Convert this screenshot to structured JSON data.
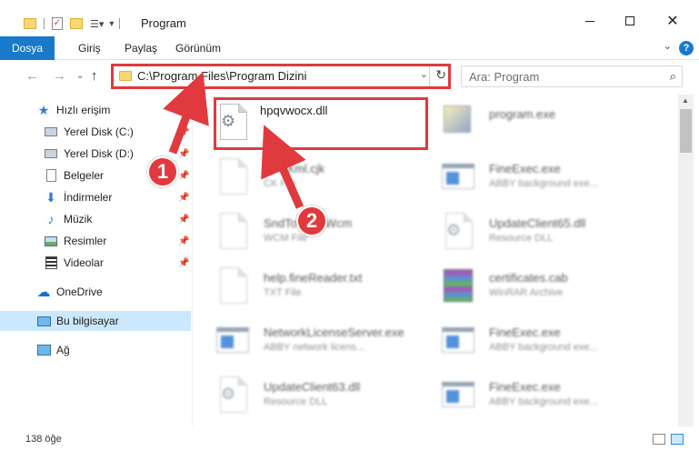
{
  "window": {
    "title": "Program",
    "min_icon": "minimize-icon",
    "max_icon": "maximize-icon",
    "close_icon": "close-icon"
  },
  "ribbon": {
    "tabs": [
      "Dosya",
      "Giriş",
      "Paylaş",
      "Görünüm"
    ],
    "accent": "#1979ca"
  },
  "nav": {
    "address": "C:\\Program Files\\Program Dizini",
    "search_placeholder": "Ara: Program"
  },
  "sidebar": {
    "items": [
      {
        "label": "Hızlı erişim",
        "icon": "star-icon"
      },
      {
        "label": "Yerel Disk (C:)",
        "icon": "drive-icon",
        "pinned": true
      },
      {
        "label": "Yerel Disk (D:)",
        "icon": "drive-icon",
        "pinned": true
      },
      {
        "label": "Belgeler",
        "icon": "document-icon",
        "pinned": true
      },
      {
        "label": "İndirmeler",
        "icon": "download-icon",
        "pinned": true
      },
      {
        "label": "Müzik",
        "icon": "music-icon",
        "pinned": true
      },
      {
        "label": "Resimler",
        "icon": "pictures-icon",
        "pinned": true
      },
      {
        "label": "Videolar",
        "icon": "video-icon",
        "pinned": true
      },
      {
        "label": "OneDrive",
        "icon": "cloud-icon"
      },
      {
        "label": "Bu bilgisayar",
        "icon": "computer-icon",
        "selected": true
      },
      {
        "label": "Ağ",
        "icon": "network-icon"
      }
    ]
  },
  "files": [
    {
      "name": "hpqvwocx.dll",
      "desc": "",
      "icon": "dll-icon"
    },
    {
      "name": "program.exe",
      "desc": "",
      "icon": "exe-icon"
    },
    {
      "name": "FineXml.cjk",
      "desc": "CK File",
      "icon": "file-icon"
    },
    {
      "name": "FineExec.exe",
      "desc": "ABBY background exe...",
      "icon": "exe-icon"
    },
    {
      "name": "SndToWordWcm",
      "desc": "WCM File",
      "icon": "file-icon"
    },
    {
      "name": "UpdateClient65.dll",
      "desc": "Resource DLL",
      "icon": "dll-icon"
    },
    {
      "name": "help.fineReader.txt",
      "desc": "TXT File",
      "icon": "file-icon"
    },
    {
      "name": "certificates.cab",
      "desc": "WinRAR Archive",
      "icon": "rar-icon"
    },
    {
      "name": "NetworkLicenseServer.exe",
      "desc": "ABBY network licens...",
      "icon": "exe-icon"
    },
    {
      "name": "FineExec.exe",
      "desc": "ABBY background exe...",
      "icon": "exe-icon"
    },
    {
      "name": "UpdateClient63.dll",
      "desc": "Resource DLL",
      "icon": "dll-icon"
    },
    {
      "name": "FineExec.exe",
      "desc": "ABBY background exe...",
      "icon": "exe-icon"
    }
  ],
  "status": {
    "count": "138 öğe"
  },
  "annotations": {
    "badge1": "1",
    "badge2": "2",
    "color": "#e0393e"
  }
}
